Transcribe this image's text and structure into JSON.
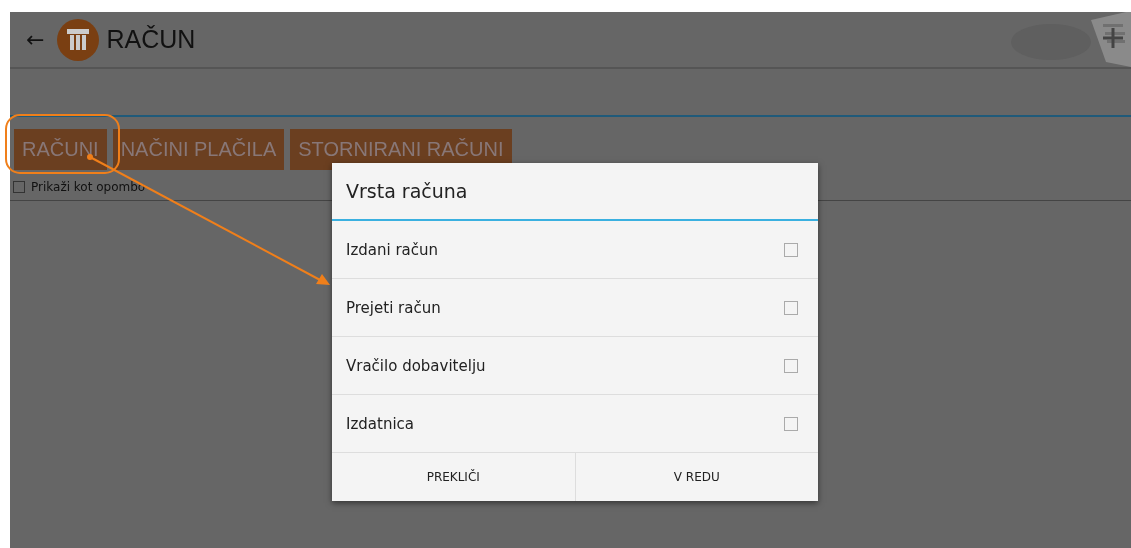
{
  "app_bar": {
    "back": "←",
    "title": "RAČUN"
  },
  "tabs": [
    "RAČUNI",
    "NAČINI PLAČILA",
    "STORNIRANI RAČUNI"
  ],
  "option": {
    "label": "Prikaži kot opombo",
    "checked": false
  },
  "dialog": {
    "title": "Vrsta računa",
    "items": [
      {
        "label": "Izdani račun",
        "checked": false
      },
      {
        "label": "Prejeti račun",
        "checked": false
      },
      {
        "label": "Vračilo dobavitelju",
        "checked": false
      },
      {
        "label": "Izdatnica",
        "checked": false
      }
    ],
    "buttons": [
      "PREKLIČI",
      "V REDU"
    ]
  }
}
